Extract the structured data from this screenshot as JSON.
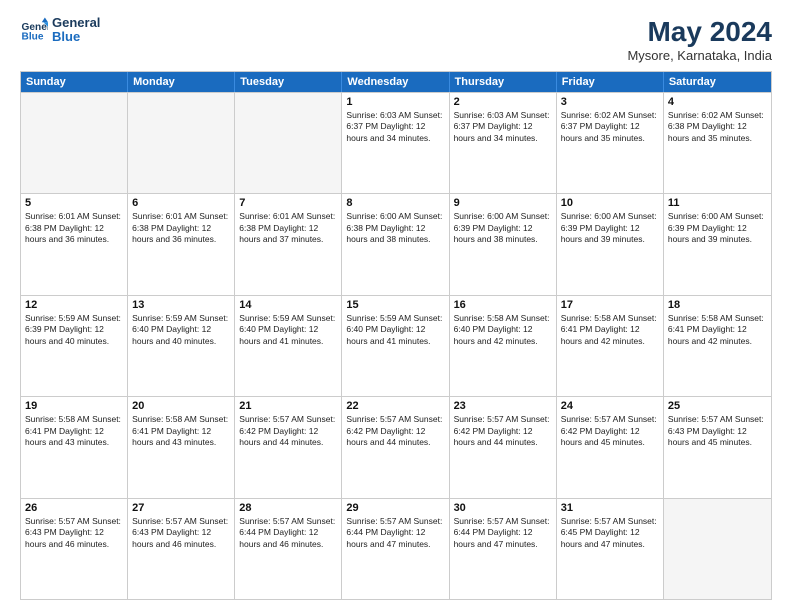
{
  "header": {
    "logo_general": "General",
    "logo_blue": "Blue",
    "month_year": "May 2024",
    "location": "Mysore, Karnataka, India"
  },
  "weekdays": [
    "Sunday",
    "Monday",
    "Tuesday",
    "Wednesday",
    "Thursday",
    "Friday",
    "Saturday"
  ],
  "rows": [
    [
      {
        "day": "",
        "info": ""
      },
      {
        "day": "",
        "info": ""
      },
      {
        "day": "",
        "info": ""
      },
      {
        "day": "1",
        "info": "Sunrise: 6:03 AM\nSunset: 6:37 PM\nDaylight: 12 hours\nand 34 minutes."
      },
      {
        "day": "2",
        "info": "Sunrise: 6:03 AM\nSunset: 6:37 PM\nDaylight: 12 hours\nand 34 minutes."
      },
      {
        "day": "3",
        "info": "Sunrise: 6:02 AM\nSunset: 6:37 PM\nDaylight: 12 hours\nand 35 minutes."
      },
      {
        "day": "4",
        "info": "Sunrise: 6:02 AM\nSunset: 6:38 PM\nDaylight: 12 hours\nand 35 minutes."
      }
    ],
    [
      {
        "day": "5",
        "info": "Sunrise: 6:01 AM\nSunset: 6:38 PM\nDaylight: 12 hours\nand 36 minutes."
      },
      {
        "day": "6",
        "info": "Sunrise: 6:01 AM\nSunset: 6:38 PM\nDaylight: 12 hours\nand 36 minutes."
      },
      {
        "day": "7",
        "info": "Sunrise: 6:01 AM\nSunset: 6:38 PM\nDaylight: 12 hours\nand 37 minutes."
      },
      {
        "day": "8",
        "info": "Sunrise: 6:00 AM\nSunset: 6:38 PM\nDaylight: 12 hours\nand 38 minutes."
      },
      {
        "day": "9",
        "info": "Sunrise: 6:00 AM\nSunset: 6:39 PM\nDaylight: 12 hours\nand 38 minutes."
      },
      {
        "day": "10",
        "info": "Sunrise: 6:00 AM\nSunset: 6:39 PM\nDaylight: 12 hours\nand 39 minutes."
      },
      {
        "day": "11",
        "info": "Sunrise: 6:00 AM\nSunset: 6:39 PM\nDaylight: 12 hours\nand 39 minutes."
      }
    ],
    [
      {
        "day": "12",
        "info": "Sunrise: 5:59 AM\nSunset: 6:39 PM\nDaylight: 12 hours\nand 40 minutes."
      },
      {
        "day": "13",
        "info": "Sunrise: 5:59 AM\nSunset: 6:40 PM\nDaylight: 12 hours\nand 40 minutes."
      },
      {
        "day": "14",
        "info": "Sunrise: 5:59 AM\nSunset: 6:40 PM\nDaylight: 12 hours\nand 41 minutes."
      },
      {
        "day": "15",
        "info": "Sunrise: 5:59 AM\nSunset: 6:40 PM\nDaylight: 12 hours\nand 41 minutes."
      },
      {
        "day": "16",
        "info": "Sunrise: 5:58 AM\nSunset: 6:40 PM\nDaylight: 12 hours\nand 42 minutes."
      },
      {
        "day": "17",
        "info": "Sunrise: 5:58 AM\nSunset: 6:41 PM\nDaylight: 12 hours\nand 42 minutes."
      },
      {
        "day": "18",
        "info": "Sunrise: 5:58 AM\nSunset: 6:41 PM\nDaylight: 12 hours\nand 42 minutes."
      }
    ],
    [
      {
        "day": "19",
        "info": "Sunrise: 5:58 AM\nSunset: 6:41 PM\nDaylight: 12 hours\nand 43 minutes."
      },
      {
        "day": "20",
        "info": "Sunrise: 5:58 AM\nSunset: 6:41 PM\nDaylight: 12 hours\nand 43 minutes."
      },
      {
        "day": "21",
        "info": "Sunrise: 5:57 AM\nSunset: 6:42 PM\nDaylight: 12 hours\nand 44 minutes."
      },
      {
        "day": "22",
        "info": "Sunrise: 5:57 AM\nSunset: 6:42 PM\nDaylight: 12 hours\nand 44 minutes."
      },
      {
        "day": "23",
        "info": "Sunrise: 5:57 AM\nSunset: 6:42 PM\nDaylight: 12 hours\nand 44 minutes."
      },
      {
        "day": "24",
        "info": "Sunrise: 5:57 AM\nSunset: 6:42 PM\nDaylight: 12 hours\nand 45 minutes."
      },
      {
        "day": "25",
        "info": "Sunrise: 5:57 AM\nSunset: 6:43 PM\nDaylight: 12 hours\nand 45 minutes."
      }
    ],
    [
      {
        "day": "26",
        "info": "Sunrise: 5:57 AM\nSunset: 6:43 PM\nDaylight: 12 hours\nand 46 minutes."
      },
      {
        "day": "27",
        "info": "Sunrise: 5:57 AM\nSunset: 6:43 PM\nDaylight: 12 hours\nand 46 minutes."
      },
      {
        "day": "28",
        "info": "Sunrise: 5:57 AM\nSunset: 6:44 PM\nDaylight: 12 hours\nand 46 minutes."
      },
      {
        "day": "29",
        "info": "Sunrise: 5:57 AM\nSunset: 6:44 PM\nDaylight: 12 hours\nand 47 minutes."
      },
      {
        "day": "30",
        "info": "Sunrise: 5:57 AM\nSunset: 6:44 PM\nDaylight: 12 hours\nand 47 minutes."
      },
      {
        "day": "31",
        "info": "Sunrise: 5:57 AM\nSunset: 6:45 PM\nDaylight: 12 hours\nand 47 minutes."
      },
      {
        "day": "",
        "info": ""
      }
    ]
  ]
}
